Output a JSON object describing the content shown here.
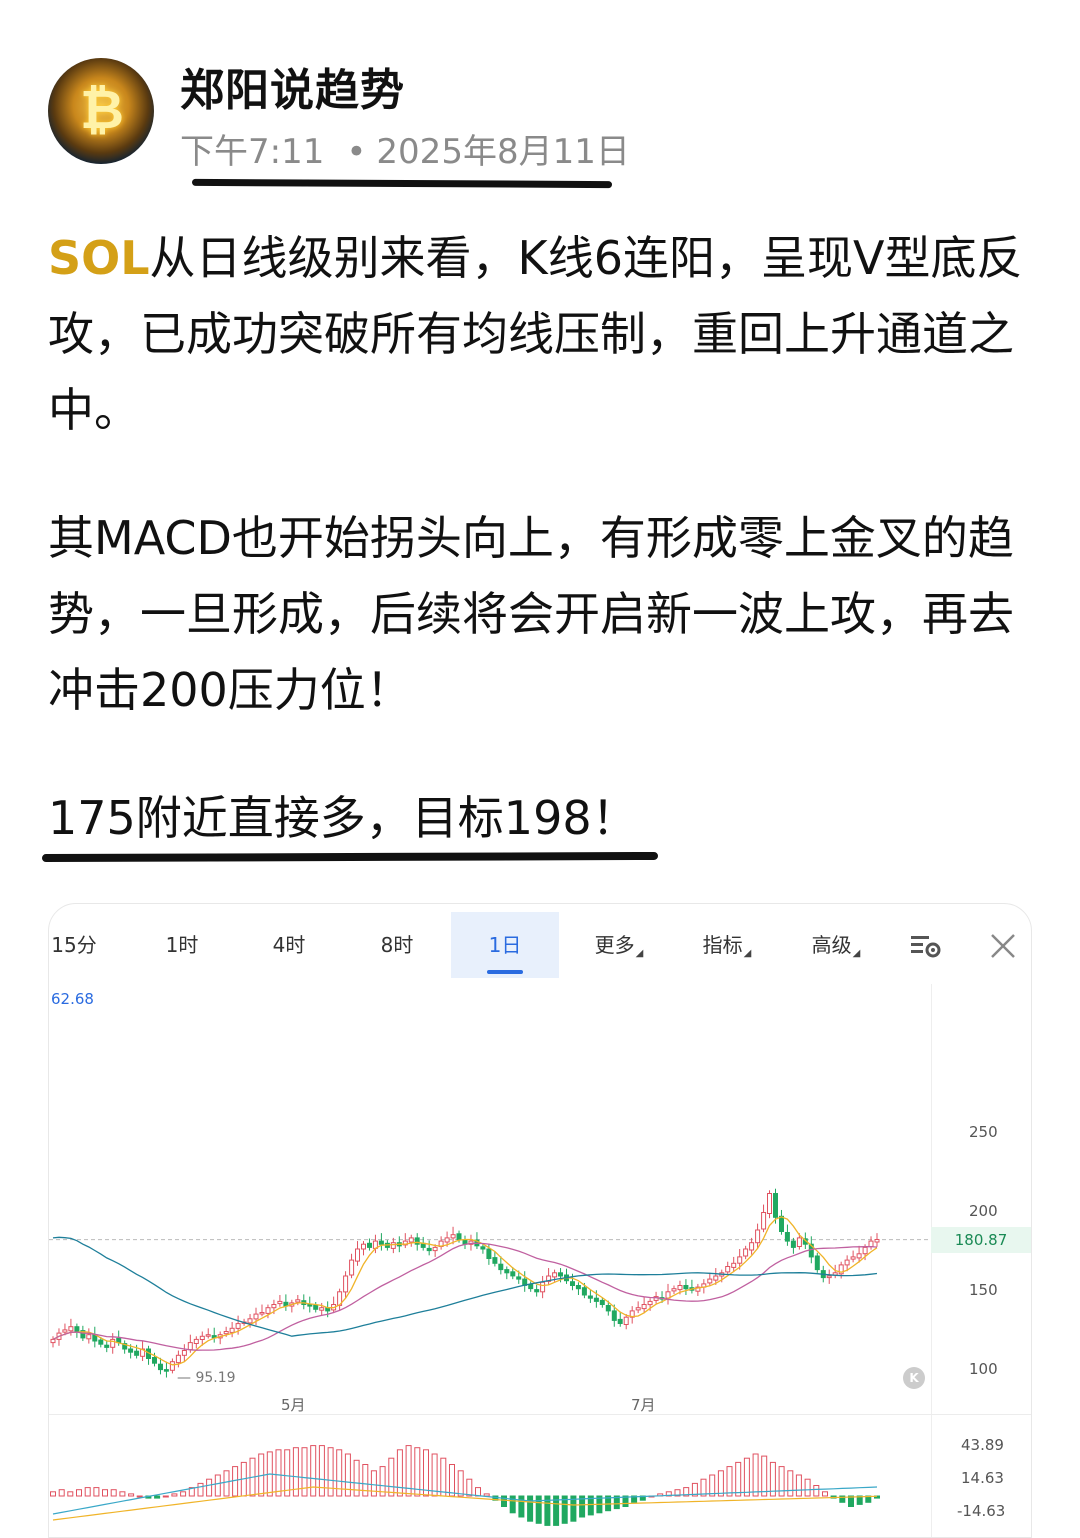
{
  "post": {
    "author": "郑阳说趋势",
    "time": "下午7:11",
    "dot": "•",
    "date": "2025年8月11日",
    "para1_ticker": "SOL",
    "para1_rest": "从日线级别来看，K线6连阳，呈现V型底反攻，已成功突破所有均线压制，重回上升通道之中。",
    "para2": "其MACD也开始拐头向上，有形成零上金叉的趋势，一旦形成，后续将会开启新一波上攻，再去冲击200压力位！",
    "para3": "175附近直接多，目标198！"
  },
  "chart": {
    "tabs": [
      "15分",
      "1时",
      "4时",
      "8时",
      "1日",
      "更多",
      "指标",
      "高级"
    ],
    "active_tab": "1日",
    "tools": [
      "chart-settings-icon",
      "close-icon"
    ],
    "high_label": "62.68",
    "low_label": "— 95.19",
    "k_badge": "K",
    "months": [
      "5月",
      "7月"
    ],
    "macd_axis": [
      "43.89",
      "14.63",
      "-14.63"
    ],
    "colors": {
      "up": "#e05260",
      "down": "#20a860",
      "ma_short": "#f0b429",
      "ma_mid": "#c060a0",
      "ma_long": "#1e7f9a",
      "accent": "#2a6be0"
    }
  },
  "chart_data": {
    "type": "candlestick",
    "price_axis": [
      250,
      200,
      150,
      100
    ],
    "last_price": "180.87",
    "closes": [
      118,
      122,
      124,
      126,
      123,
      119,
      121,
      117,
      115,
      113,
      118,
      116,
      112,
      110,
      108,
      112,
      106,
      103,
      99,
      98,
      104,
      108,
      111,
      116,
      118,
      120,
      121,
      119,
      121,
      123,
      125,
      128,
      129,
      131,
      134,
      135,
      138,
      140,
      142,
      139,
      141,
      143,
      140,
      139,
      137,
      138,
      136,
      140,
      148,
      158,
      168,
      175,
      178,
      176,
      180,
      178,
      176,
      179,
      177,
      180,
      182,
      178,
      176,
      174,
      176,
      180,
      182,
      184,
      181,
      178,
      180,
      177,
      175,
      169,
      166,
      162,
      160,
      158,
      156,
      152,
      150,
      148,
      154,
      158,
      160,
      158,
      155,
      152,
      150,
      146,
      144,
      142,
      140,
      136,
      130,
      128,
      132,
      136,
      138,
      140,
      142,
      145,
      144,
      148,
      150,
      152,
      150,
      149,
      151,
      153,
      156,
      158,
      160,
      164,
      166,
      170,
      175,
      179,
      187,
      198,
      210,
      195,
      186,
      180,
      176,
      182,
      178,
      170,
      162,
      157,
      158,
      160,
      165,
      168,
      170,
      172,
      176,
      180,
      181
    ],
    "macd_hist": [
      2,
      3,
      2,
      3,
      4,
      4,
      3,
      3,
      2,
      1,
      0,
      -1,
      -1,
      0,
      1,
      2,
      4,
      6,
      8,
      10,
      12,
      14,
      16,
      18,
      20,
      21,
      22,
      22,
      23,
      23,
      24,
      24,
      23,
      22,
      20,
      17,
      15,
      12,
      14,
      18,
      22,
      24,
      23,
      22,
      20,
      18,
      15,
      12,
      8,
      4,
      1,
      -2,
      -5,
      -8,
      -10,
      -12,
      -13,
      -14,
      -14,
      -13,
      -12,
      -10,
      -9,
      -8,
      -7,
      -6,
      -5,
      -3,
      -2,
      0,
      1,
      2,
      3,
      4,
      6,
      8,
      10,
      12,
      14,
      16,
      18,
      20,
      19,
      16,
      14,
      12,
      10,
      8,
      5,
      2,
      -1,
      -3,
      -5,
      -4,
      -3,
      -1
    ]
  }
}
